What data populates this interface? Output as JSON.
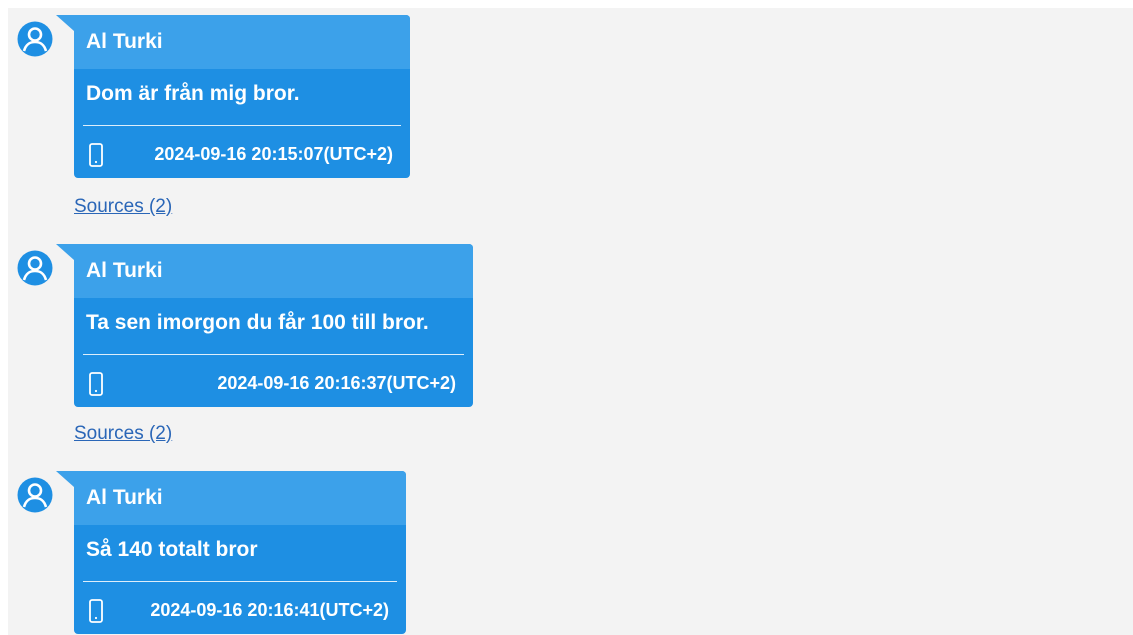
{
  "colors": {
    "background": "#f3f3f3",
    "bubble_body": "#1e8fe3",
    "bubble_header": "#3ca1ea",
    "link": "#2a66b7",
    "avatar": "#1e8fe3"
  },
  "icons": {
    "avatar": "user-avatar-icon",
    "device": "mobile-phone-icon"
  },
  "messages": [
    {
      "sender": "Al Turki",
      "text": "Dom är från mig bror.",
      "timestamp": "2024-09-16 20:15:07(UTC+2)",
      "sources_label": "Sources (2)"
    },
    {
      "sender": "Al Turki",
      "text": "Ta sen imorgon du får 100 till bror.",
      "timestamp": "2024-09-16 20:16:37(UTC+2)",
      "sources_label": "Sources (2)"
    },
    {
      "sender": "Al Turki",
      "text": "Så 140 totalt bror",
      "timestamp": "2024-09-16 20:16:41(UTC+2)"
    }
  ]
}
